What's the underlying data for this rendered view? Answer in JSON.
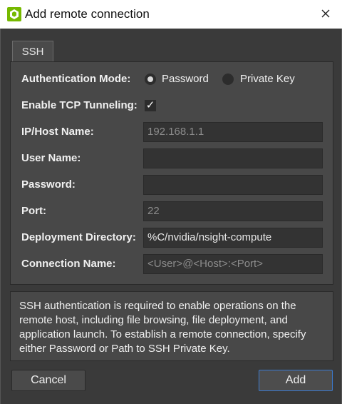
{
  "window": {
    "title": "Add remote connection",
    "icon": "nsight-compute-app-icon",
    "close": "close-icon"
  },
  "tab": {
    "label": "SSH"
  },
  "form": {
    "auth_mode": {
      "label": "Authentication Mode:",
      "options": [
        "Password",
        "Private Key"
      ],
      "selected": "Password"
    },
    "tcp_tunneling": {
      "label": "Enable TCP Tunneling:",
      "checked": true,
      "mark": "✓"
    },
    "host": {
      "label": "IP/Host Name:",
      "value": "",
      "placeholder": "192.168.1.1"
    },
    "user": {
      "label": "User Name:",
      "value": "",
      "placeholder": ""
    },
    "password": {
      "label": "Password:",
      "value": "",
      "placeholder": ""
    },
    "port": {
      "label": "Port:",
      "value": "",
      "placeholder": "22"
    },
    "deploy_dir": {
      "label": "Deployment Directory:",
      "value": "%C/nvidia/nsight-compute",
      "placeholder": ""
    },
    "conn_name": {
      "label": "Connection Name:",
      "value": "",
      "placeholder": "<User>@<Host>:<Port>"
    }
  },
  "info_text": "SSH authentication is required to enable operations on the remote host, including file browsing, file deployment, and application launch. To establish a remote connection, specify either Password or Path to SSH Private Key.",
  "buttons": {
    "cancel": "Cancel",
    "add": "Add"
  },
  "colors": {
    "accent": "#3a7ad0",
    "background": "#3a3a3a",
    "panel": "#484848",
    "field": "#333333"
  }
}
